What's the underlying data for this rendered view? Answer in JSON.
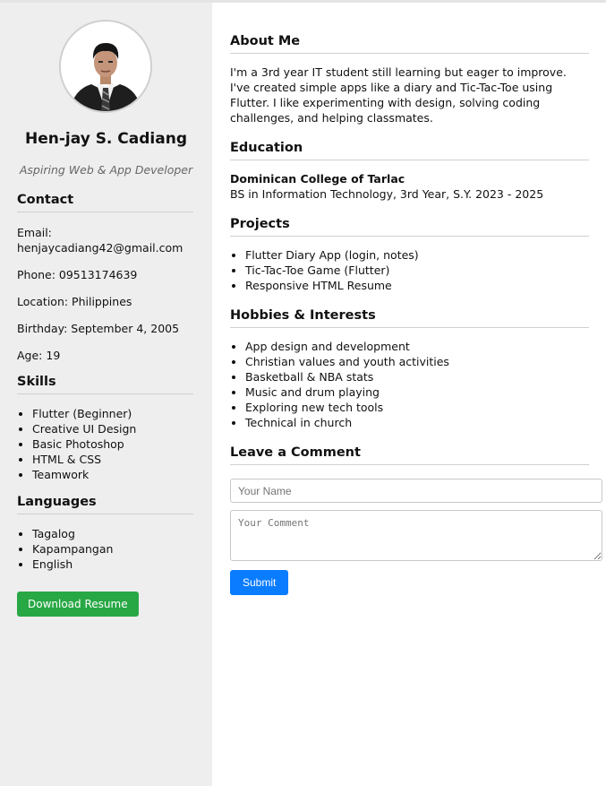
{
  "profile": {
    "name": "Hen-jay S. Cadiang",
    "tagline": "Aspiring Web & App Developer"
  },
  "contact": {
    "title": "Contact",
    "email": "Email: henjaycadiang42@gmail.com",
    "phone": "Phone: 09513174639",
    "location": "Location: Philippines",
    "birthday": "Birthday: September 4, 2005",
    "age": "Age: 19"
  },
  "skills": {
    "title": "Skills",
    "items": [
      "Flutter (Beginner)",
      "Creative UI Design",
      "Basic Photoshop",
      "HTML & CSS",
      "Teamwork"
    ]
  },
  "languages": {
    "title": "Languages",
    "items": [
      "Tagalog",
      "Kapampangan",
      "English"
    ]
  },
  "download_label": "Download Resume",
  "about": {
    "title": "About Me",
    "text": "I'm a 3rd year IT student still learning but eager to improve. I've created simple apps like a diary and Tic-Tac-Toe using Flutter. I like experimenting with design, solving coding challenges, and helping classmates."
  },
  "education": {
    "title": "Education",
    "school": "Dominican College of Tarlac",
    "detail": "BS in Information Technology, 3rd Year, S.Y. 2023 - 2025"
  },
  "projects": {
    "title": "Projects",
    "items": [
      "Flutter Diary App (login, notes)",
      "Tic-Tac-Toe Game (Flutter)",
      "Responsive HTML Resume"
    ]
  },
  "hobbies": {
    "title": "Hobbies & Interests",
    "items": [
      "App design and development",
      "Christian values and youth activities",
      "Basketball & NBA stats",
      "Music and drum playing",
      "Exploring new tech tools",
      "Technical in church"
    ]
  },
  "comment": {
    "title": "Leave a Comment",
    "name_placeholder": "Your Name",
    "comment_placeholder": "Your Comment",
    "submit_label": "Submit"
  },
  "colors": {
    "sidebar_bg": "#eeeeee",
    "download_button": "#28a745",
    "submit_button": "#0a7cff"
  }
}
